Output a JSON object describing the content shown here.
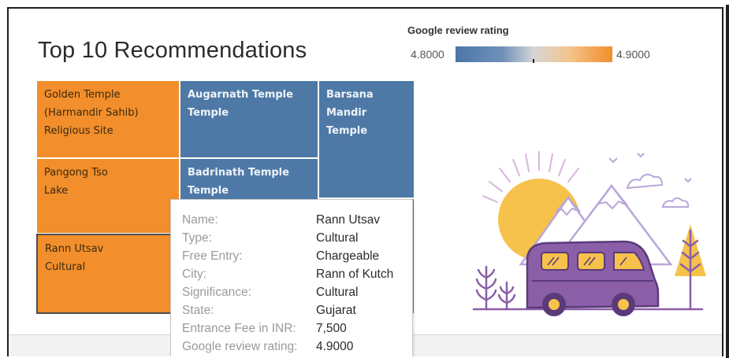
{
  "title": "Top 10 Recommendations",
  "legend": {
    "title": "Google review rating",
    "min_label": "4.8000",
    "max_label": "4.9000",
    "color_low": "#4b76a8",
    "color_mid": "#d6d6d6",
    "color_high": "#f28e2b",
    "marker_value": 4.85
  },
  "colors": {
    "orange": "#f28e2b",
    "blue": "#4e79a7"
  },
  "treemap": {
    "tiles": [
      {
        "id": "golden",
        "lines": [
          "Golden Temple",
          "(Harmandir Sahib)",
          "Religious Site"
        ],
        "color": "orange"
      },
      {
        "id": "augarnath",
        "lines": [
          "Augarnath Temple",
          "Temple"
        ],
        "color": "blue"
      },
      {
        "id": "barsana",
        "lines": [
          "Barsana",
          "Mandir",
          "Temple"
        ],
        "color": "blue"
      },
      {
        "id": "pangong",
        "lines": [
          "Pangong Tso",
          "Lake"
        ],
        "color": "orange"
      },
      {
        "id": "badrinath",
        "lines": [
          "Badrinath Temple",
          "Temple"
        ],
        "color": "blue"
      },
      {
        "id": "rann",
        "lines": [
          "Rann Utsav",
          "Cultural"
        ],
        "color": "orange"
      }
    ]
  },
  "tooltip": {
    "rows": [
      {
        "label": "Name:",
        "value": "Rann Utsav"
      },
      {
        "label": "Type:",
        "value": "Cultural"
      },
      {
        "label": "Free Entry:",
        "value": "Chargeable"
      },
      {
        "label": "City:",
        "value": "Rann of Kutch"
      },
      {
        "label": "Significance:",
        "value": "Cultural"
      },
      {
        "label": "State:",
        "value": "Gujarat"
      },
      {
        "label": "Entrance Fee in INR:",
        "value": "7,500"
      },
      {
        "label": "Google review rating:",
        "value": "4.9000"
      }
    ]
  },
  "illustration": {
    "name": "travel-van-mountains-illustration"
  }
}
